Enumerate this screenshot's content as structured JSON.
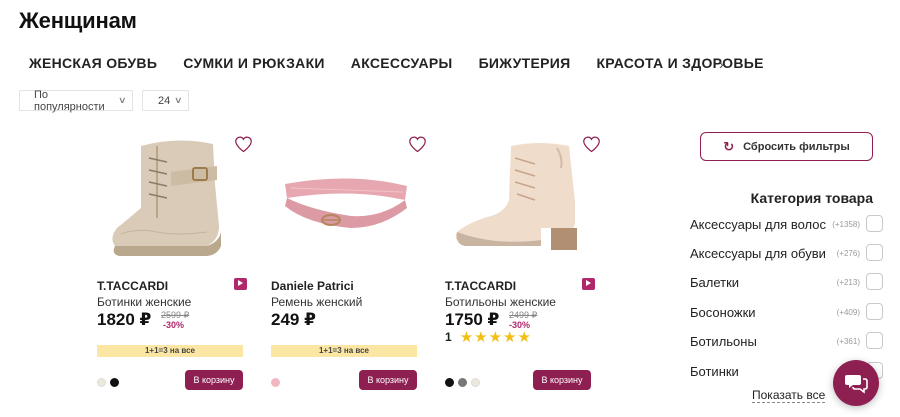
{
  "page": {
    "title": "Женщинам"
  },
  "categories": [
    "ЖЕНСКАЯ ОБУВЬ",
    "СУМКИ И РЮКЗАКИ",
    "АКСЕССУАРЫ",
    "БИЖУТЕРИЯ",
    "КРАСОТА И ЗДОРОВЬЕ"
  ],
  "sort": {
    "value": "По популярности",
    "per_page": "24"
  },
  "products": [
    {
      "brand": "T.TACCARDI",
      "name": "Ботинки женские",
      "price": "1820 ₽",
      "old_price": "2599 ₽",
      "discount": "-30%",
      "promo": "1+1=3 на все",
      "cart": "В корзину",
      "has_video": true,
      "swatch_colors": [
        "#ece9dc",
        "#111111"
      ]
    },
    {
      "brand": "Daniele Patrici",
      "name": "Ремень женский",
      "price": "249 ₽",
      "promo": "1+1=3 на все",
      "cart": "В корзину",
      "has_video": false,
      "swatch_colors": [
        "#f2b6c1"
      ]
    },
    {
      "brand": "T.TACCARDI",
      "name": "Ботильоны женские",
      "price": "1750 ₽",
      "old_price": "2499 ₽",
      "discount": "-30%",
      "rating": "1",
      "stars": 5,
      "cart": "В корзину",
      "has_video": true,
      "swatch_colors": [
        "#111111",
        "#777777",
        "#ece9dc"
      ]
    }
  ],
  "filters": {
    "reset_label": "Сбросить фильтры",
    "title": "Категория товара",
    "items": [
      {
        "label": "Аксессуары для волос",
        "count": "(+1358)"
      },
      {
        "label": "Аксессуары для обуви",
        "count": "(+276)"
      },
      {
        "label": "Балетки",
        "count": "(+213)"
      },
      {
        "label": "Босоножки",
        "count": "(+409)"
      },
      {
        "label": "Ботильоны",
        "count": "(+361)"
      },
      {
        "label": "Ботинки",
        "count": ""
      }
    ],
    "show_all": "Показать все"
  },
  "colors": {
    "accent": "#8e1f51",
    "promo_bg": "#fce6a4",
    "star": "#f2bf17"
  }
}
